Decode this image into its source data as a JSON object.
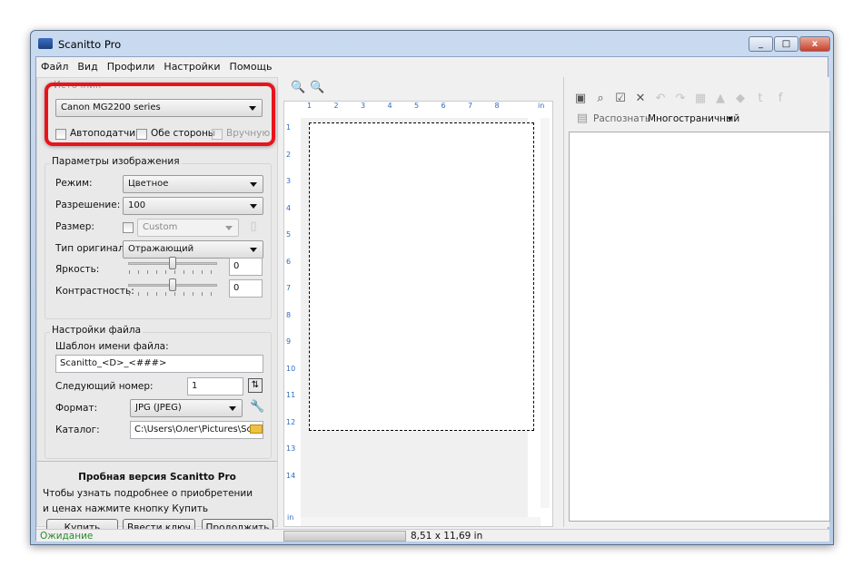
{
  "window": {
    "title": "Scanitto Pro",
    "minimize": "_",
    "maximize": "□",
    "close": "x"
  },
  "menu": [
    "Файл",
    "Вид",
    "Профили",
    "Настройки",
    "Помощь"
  ],
  "source": {
    "label": "Источник",
    "device": "Canon MG2200 series",
    "autofeeder": "Автоподатчик",
    "duplex": "Обе стороны",
    "manual": "Вручную",
    "highlight_color": "#e8141c"
  },
  "image": {
    "label": "Параметры изображения",
    "mode_label": "Режим:",
    "mode": "Цветное",
    "resolution_label": "Разрешение:",
    "resolution": "100",
    "size_label": "Размер:",
    "size": "Custom",
    "original_label": "Тип оригинала:",
    "original": "Отражающий",
    "brightness_label": "Яркость:",
    "brightness": "0",
    "contrast_label": "Контрастность:",
    "contrast": "0"
  },
  "file": {
    "label": "Настройки файла",
    "template_label": "Шаблон имени файла:",
    "template": "Scanitto_<D>_<###>",
    "next_label": "Следующий номер:",
    "next": "1",
    "format_label": "Формат:",
    "format": "JPG (JPEG)",
    "folder_label": "Каталог:",
    "folder": "C:\\Users\\Олег\\Pictures\\Scanitto"
  },
  "trial": {
    "title": "Пробная версия Scanitto Pro",
    "line1": "Чтобы узнать подробнее о приобретении",
    "line2": "и ценах нажмите кнопку Купить",
    "buy": "Купить",
    "key": "Ввести ключ",
    "continue": "Продолжить"
  },
  "preview": {
    "ruler_h": [
      "1",
      "2",
      "3",
      "4",
      "5",
      "6",
      "7",
      "8"
    ],
    "ruler_v": [
      "1",
      "2",
      "3",
      "4",
      "5",
      "6",
      "7",
      "8",
      "9",
      "10",
      "11",
      "12",
      "13",
      "14"
    ],
    "unit": "in"
  },
  "right": {
    "recognize": "Распознать",
    "mode": "Многостраничный",
    "dropdown": "▾"
  },
  "status": {
    "text": "Ожидание",
    "size": "8,51 x 11,69 in",
    "text_color": "#2a8a2a",
    "progress": 0
  }
}
